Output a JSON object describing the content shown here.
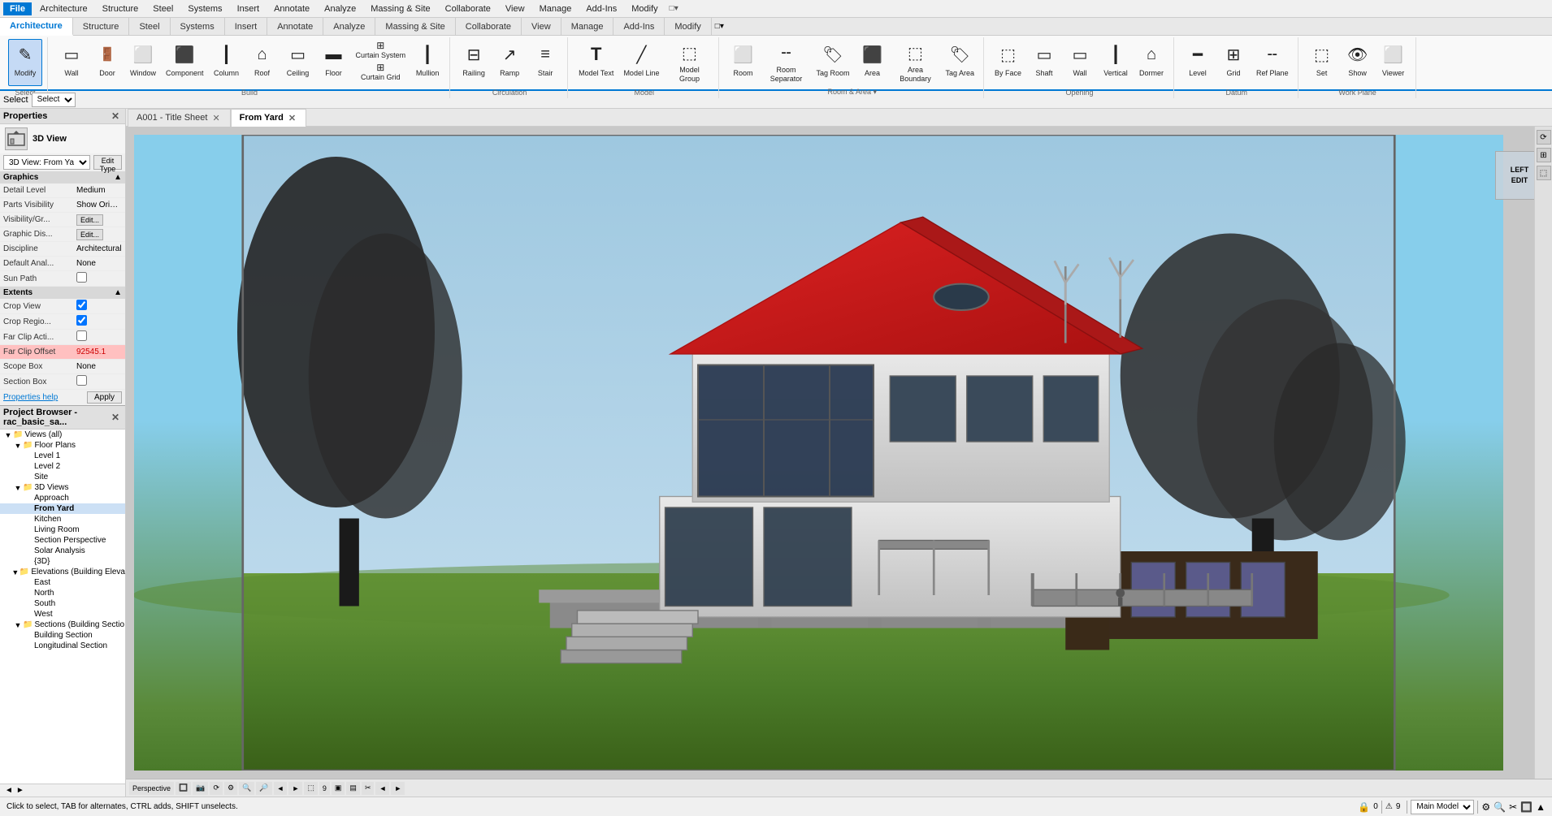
{
  "menubar": {
    "items": [
      "File",
      "Architecture",
      "Structure",
      "Steel",
      "Systems",
      "Insert",
      "Annotate",
      "Analyze",
      "Massing & Site",
      "Collaborate",
      "View",
      "Manage",
      "Add-Ins",
      "Modify"
    ]
  },
  "ribbon": {
    "tabs": [
      "Modify",
      "Architecture",
      "Structure",
      "Steel",
      "Systems",
      "Insert",
      "Annotate",
      "Analyze",
      "Massing & Site",
      "Collaborate",
      "View",
      "Manage",
      "Add-Ins"
    ],
    "active_tab": "Architecture",
    "groups": {
      "select": {
        "label": "Select",
        "dropdown": "Select ▾"
      },
      "build": {
        "label": "Build",
        "buttons": [
          {
            "id": "modify",
            "icon": "✎",
            "label": "Modify",
            "active": true
          },
          {
            "id": "wall",
            "icon": "▭",
            "label": "Wall"
          },
          {
            "id": "door",
            "icon": "🚪",
            "label": "Door"
          },
          {
            "id": "window",
            "icon": "⬜",
            "label": "Window"
          },
          {
            "id": "component",
            "icon": "⬛",
            "label": "Component"
          },
          {
            "id": "column",
            "icon": "┃",
            "label": "Column"
          },
          {
            "id": "roof",
            "icon": "⌂",
            "label": "Roof"
          },
          {
            "id": "ceiling",
            "icon": "▭",
            "label": "Ceiling"
          },
          {
            "id": "floor",
            "icon": "▬",
            "label": "Floor"
          },
          {
            "id": "curtain_system",
            "icon": "⊞",
            "label": "Curtain System"
          },
          {
            "id": "curtain_grid",
            "icon": "⊞",
            "label": "Curtain Grid"
          },
          {
            "id": "mullion",
            "icon": "┃",
            "label": "Mullion"
          }
        ]
      },
      "circulation": {
        "label": "Circulation",
        "buttons": [
          {
            "id": "railing",
            "icon": "⊟",
            "label": "Railing"
          },
          {
            "id": "ramp",
            "icon": "↗",
            "label": "Ramp"
          },
          {
            "id": "stair",
            "icon": "≡",
            "label": "Stair"
          }
        ]
      },
      "model": {
        "label": "Model",
        "buttons": [
          {
            "id": "model_text",
            "icon": "T",
            "label": "Model Text"
          },
          {
            "id": "model_line",
            "icon": "╱",
            "label": "Model Line"
          },
          {
            "id": "model_group",
            "icon": "⬚",
            "label": "Model Group"
          }
        ]
      },
      "room_area": {
        "label": "Room & Area",
        "buttons": [
          {
            "id": "room",
            "icon": "⬜",
            "label": "Room"
          },
          {
            "id": "room_separator",
            "icon": "╌",
            "label": "Room Separator"
          },
          {
            "id": "tag_room",
            "icon": "🏷",
            "label": "Tag Room"
          },
          {
            "id": "area",
            "icon": "⬛",
            "label": "Area"
          },
          {
            "id": "area_boundary",
            "icon": "⬚",
            "label": "Area Boundary"
          },
          {
            "id": "tag_area",
            "icon": "🏷",
            "label": "Tag Area"
          }
        ],
        "dropdown_label": "Room & Area ▾"
      },
      "opening": {
        "label": "Opening",
        "buttons": [
          {
            "id": "by_face",
            "icon": "⬚",
            "label": "By Face"
          },
          {
            "id": "shaft",
            "icon": "▭",
            "label": "Shaft"
          },
          {
            "id": "wall_opening",
            "icon": "▭",
            "label": "Wall"
          },
          {
            "id": "vertical",
            "icon": "┃",
            "label": "Vertical"
          },
          {
            "id": "dormer",
            "icon": "⌂",
            "label": "Dormer"
          }
        ]
      },
      "datum": {
        "label": "Datum",
        "buttons": [
          {
            "id": "level",
            "icon": "━",
            "label": "Level"
          },
          {
            "id": "grid",
            "icon": "⊞",
            "label": "Grid"
          },
          {
            "id": "ref_plane",
            "icon": "╌",
            "label": "Ref Plane"
          }
        ]
      },
      "work_plane": {
        "label": "Work Plane",
        "buttons": [
          {
            "id": "set",
            "icon": "⬚",
            "label": "Set"
          },
          {
            "id": "show",
            "icon": "👁",
            "label": "Show"
          },
          {
            "id": "viewer",
            "icon": "⬜",
            "label": "Viewer"
          }
        ]
      }
    }
  },
  "properties": {
    "title": "Properties",
    "type_icon": "3D",
    "type_label": "3D View",
    "dropdown_value": "3D View: From Ya",
    "edit_type_label": "Edit Type",
    "graphics_section": "Graphics",
    "rows": [
      {
        "name": "Detail Level",
        "value": "Medium"
      },
      {
        "name": "Parts Visibility",
        "value": "Show Original"
      },
      {
        "name": "Visibility/Gr...",
        "value_type": "edit",
        "btn": "Edit..."
      },
      {
        "name": "Graphic Dis...",
        "value_type": "edit",
        "btn": "Edit..."
      },
      {
        "name": "Discipline",
        "value": "Architectural"
      },
      {
        "name": "Default Anal...",
        "value": "None"
      },
      {
        "name": "Sun Path",
        "value_type": "checkbox",
        "checked": false
      }
    ],
    "extents_section": "Extents",
    "extents_rows": [
      {
        "name": "Crop View",
        "value_type": "checkbox",
        "checked": true
      },
      {
        "name": "Crop Regio...",
        "value_type": "checkbox",
        "checked": true
      },
      {
        "name": "Far Clip Acti...",
        "value_type": "checkbox",
        "checked": false
      },
      {
        "name": "Far Clip Offset",
        "value": "92545.1",
        "red": true
      },
      {
        "name": "Scope Box",
        "value": "None"
      },
      {
        "name": "Section Box",
        "value_type": "checkbox",
        "checked": false
      }
    ],
    "help_link": "Properties help",
    "apply_btn": "Apply"
  },
  "project_browser": {
    "title": "Project Browser - rac_basic_sa...",
    "tree": [
      {
        "id": "views",
        "label": "Views (all)",
        "level": 0,
        "type": "folder",
        "expanded": true
      },
      {
        "id": "floor_plans",
        "label": "Floor Plans",
        "level": 1,
        "type": "folder",
        "expanded": true
      },
      {
        "id": "level1",
        "label": "Level 1",
        "level": 2,
        "type": "view"
      },
      {
        "id": "level2",
        "label": "Level 2",
        "level": 2,
        "type": "view"
      },
      {
        "id": "site",
        "label": "Site",
        "level": 2,
        "type": "view"
      },
      {
        "id": "3dviews",
        "label": "3D Views",
        "level": 1,
        "type": "folder",
        "expanded": true
      },
      {
        "id": "approach",
        "label": "Approach",
        "level": 2,
        "type": "view"
      },
      {
        "id": "fromyard",
        "label": "From Yard",
        "level": 2,
        "type": "view",
        "selected": true,
        "bold": true
      },
      {
        "id": "kitchen",
        "label": "Kitchen",
        "level": 2,
        "type": "view"
      },
      {
        "id": "livingroom",
        "label": "Living Room",
        "level": 2,
        "type": "view"
      },
      {
        "id": "sectionperspective",
        "label": "Section Perspective",
        "level": 2,
        "type": "view"
      },
      {
        "id": "solaranalysis",
        "label": "Solar Analysis",
        "level": 2,
        "type": "view"
      },
      {
        "id": "3d",
        "label": "{3D}",
        "level": 2,
        "type": "view"
      },
      {
        "id": "elevations",
        "label": "Elevations (Building Eleva",
        "level": 1,
        "type": "folder",
        "expanded": true
      },
      {
        "id": "east",
        "label": "East",
        "level": 2,
        "type": "view"
      },
      {
        "id": "north",
        "label": "North",
        "level": 2,
        "type": "view"
      },
      {
        "id": "south",
        "label": "South",
        "level": 2,
        "type": "view"
      },
      {
        "id": "west",
        "label": "West",
        "level": 2,
        "type": "view"
      },
      {
        "id": "sections",
        "label": "Sections (Building Sectio",
        "level": 1,
        "type": "folder",
        "expanded": true
      },
      {
        "id": "buildingsection",
        "label": "Building Section",
        "level": 2,
        "type": "view"
      },
      {
        "id": "longitudinalsection",
        "label": "Longitudinal Section",
        "level": 2,
        "type": "view"
      }
    ]
  },
  "tabs": [
    {
      "id": "title_sheet",
      "label": "A001 - Title Sheet",
      "closeable": true
    },
    {
      "id": "from_yard",
      "label": "From Yard",
      "closeable": true,
      "active": true
    }
  ],
  "view_controls": {
    "perspective_label": "Perspective",
    "buttons": [
      "🔲",
      "📷",
      "⟳",
      "⚙",
      "🔍",
      "🔎",
      "←",
      "→",
      "↑",
      "↓",
      "⬚",
      "9",
      "▣",
      "🔲",
      "▤",
      "✂",
      "◄",
      "►"
    ]
  },
  "status_bar": {
    "left_text": "Click to select, TAB for alternates, CTRL adds, SHIFT unselects.",
    "center_icons": [
      "🔒",
      "0"
    ],
    "model_label": "Main Model",
    "right_icons": [
      "⚙",
      "🔍",
      "✂",
      "🔲",
      "▲"
    ]
  },
  "viewcube": {
    "top_label": "LEFT",
    "right_label": "EDIT"
  },
  "colors": {
    "accent": "#0078d4",
    "active_bg": "#c5daf5",
    "ribbon_bg": "#f9f9f9",
    "tab_active_bg": "#ffffff",
    "status_bg": "#f0f0f0"
  }
}
